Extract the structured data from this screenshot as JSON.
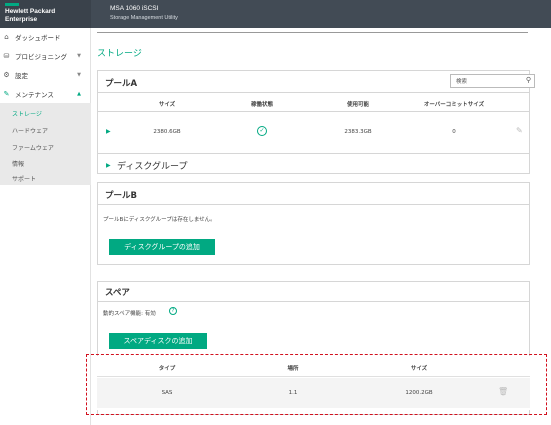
{
  "header": {
    "logo_line1": "Hewlett Packard",
    "logo_line2": "Enterprise",
    "system_name": "MSA 1060 iSCSI",
    "system_subtitle": "Storage Management Utility"
  },
  "sidebar": {
    "items": [
      {
        "label": "ダッシュボード",
        "icon": "home-icon"
      },
      {
        "label": "プロビジョニング",
        "icon": "storage-icon"
      },
      {
        "label": "設定",
        "icon": "gear-icon"
      },
      {
        "label": "メンテナンス",
        "icon": "wrench-icon"
      }
    ],
    "sub_items": [
      "ストレージ",
      "ハードウェア",
      "ファームウェア",
      "情報",
      "サポート"
    ]
  },
  "main": {
    "title": "ストレージ",
    "pool_a": {
      "title": "プールA",
      "search_placeholder": "検索",
      "columns": [
        "サイズ",
        "稼働状態",
        "使用可能",
        "オーバーコミットサイズ"
      ],
      "row": {
        "size": "2380.6GB",
        "available": "2383.3GB",
        "overcommit": "0"
      },
      "disk_group_label": "ディスクグループ"
    },
    "pool_b": {
      "title": "プールB",
      "message": "プールBにディスクグループは存在しません。",
      "add_button": "ディスクグループの追加"
    },
    "spare": {
      "title": "スペア",
      "dynamic_label": "動的スペア機能: 有効",
      "add_button": "スペアディスクの追加",
      "columns": [
        "タイプ",
        "場所",
        "サイズ"
      ],
      "row": {
        "type": "SAS",
        "location": "1.1",
        "size": "1200.2GB"
      }
    }
  }
}
